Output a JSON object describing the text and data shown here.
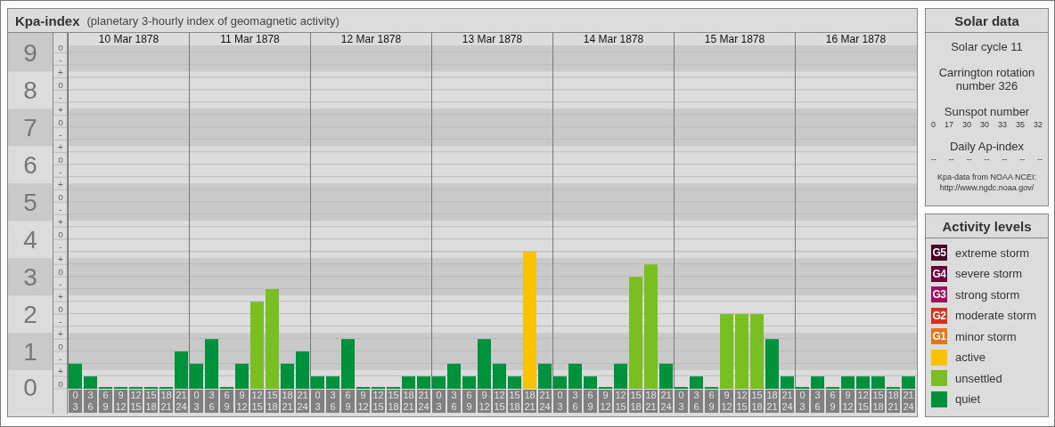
{
  "kpa_panel": {
    "title": "Kpa-index",
    "subtitle": "(planetary 3-hourly index of geomagnetic activity)",
    "days": [
      "10 Mar 1878",
      "11 Mar 1878",
      "12 Mar 1878",
      "13 Mar 1878",
      "14 Mar 1878",
      "15 Mar 1878",
      "16 Mar 1878"
    ],
    "y_sublabels": [
      "o",
      "-",
      "+",
      "o",
      "-",
      "+",
      "o",
      "-",
      "+",
      "o",
      "-",
      "+",
      "o",
      "-",
      "+",
      "o",
      "-",
      "+",
      "o",
      "-",
      "+",
      "o",
      "-",
      "+",
      "o",
      "-",
      "+",
      "o"
    ],
    "chart_data": {
      "type": "bar",
      "ylim": [
        0,
        9.2
      ],
      "grid": true,
      "yticks": [
        {
          "value": 0,
          "label": "0"
        },
        {
          "value": 1,
          "label": "1"
        },
        {
          "value": 2,
          "label": "2"
        },
        {
          "value": 3,
          "label": "3"
        },
        {
          "value": 4,
          "label": "4"
        },
        {
          "value": 5,
          "label": "5"
        },
        {
          "value": 6,
          "label": "6"
        },
        {
          "value": 7,
          "label": "7"
        },
        {
          "value": 8,
          "label": "8"
        },
        {
          "value": 9,
          "label": "9"
        }
      ],
      "categories": [
        "0 3",
        "3 6",
        "6 9",
        "9 12",
        "12 15",
        "15 18",
        "18 21",
        "21 24",
        "0 3",
        "3 6",
        "6 9",
        "9 12",
        "12 15",
        "15 18",
        "18 21",
        "21 24",
        "0 3",
        "3 6",
        "6 9",
        "9 12",
        "12 15",
        "15 18",
        "18 21",
        "21 24",
        "0 3",
        "3 6",
        "6 9",
        "9 12",
        "12 15",
        "15 18",
        "18 21",
        "21 24",
        "0 3",
        "3 6",
        "6 9",
        "9 12",
        "12 15",
        "15 18",
        "18 21",
        "21 24",
        "0 3",
        "3 6",
        "6 9",
        "9 12",
        "12 15",
        "15 18",
        "18 21",
        "21 24",
        "0 3",
        "3 6",
        "6 9",
        "9 12",
        "12 15",
        "15 18",
        "18 21",
        "21 24"
      ],
      "values": [
        0.67,
        0.33,
        0,
        0,
        0,
        0,
        0,
        1,
        0.67,
        1.33,
        0,
        0.67,
        2.33,
        2.67,
        0.67,
        1,
        0.33,
        0.33,
        1.33,
        0,
        0,
        0,
        0.33,
        0.33,
        0.33,
        0.67,
        0.33,
        1.33,
        0.67,
        0.33,
        3.67,
        0.67,
        0.33,
        0.67,
        0.33,
        0,
        0.67,
        3,
        3.33,
        0.67,
        0,
        0.33,
        0,
        2,
        2,
        2,
        1.33,
        0.33,
        0,
        0.33,
        0,
        0.33,
        0.33,
        0.33,
        0,
        0.33
      ]
    }
  },
  "solar_data": {
    "title": "Solar data",
    "solar_cycle": "Solar cycle 11",
    "carrington": "Carrington rotation number 326",
    "sunspot_label": "Sunspot number",
    "sunspot_numbers": [
      "0",
      "17",
      "30",
      "30",
      "33",
      "35",
      "32"
    ],
    "ap_label": "Daily Ap-index",
    "ap_values": [
      "--",
      "--",
      "--",
      "--",
      "--",
      "--",
      "--"
    ],
    "source_note": "Kpa-data from NOAA NCEI:",
    "source_link": "http://www.ngdc.noaa.gov/"
  },
  "activity_levels": {
    "title": "Activity levels",
    "items": [
      {
        "badge": "G5",
        "label": "extreme storm",
        "color": "#4a0022"
      },
      {
        "badge": "G4",
        "label": "severe storm",
        "color": "#6e0039"
      },
      {
        "badge": "G3",
        "label": "strong storm",
        "color": "#a30b62"
      },
      {
        "badge": "G2",
        "label": "moderate storm",
        "color": "#d8311c"
      },
      {
        "badge": "G1",
        "label": "minor storm",
        "color": "#e5751b"
      },
      {
        "label": "active",
        "color": "#f9c300"
      },
      {
        "label": "unsettled",
        "color": "#7abf22"
      },
      {
        "label": "quiet",
        "color": "#00913d"
      }
    ]
  }
}
